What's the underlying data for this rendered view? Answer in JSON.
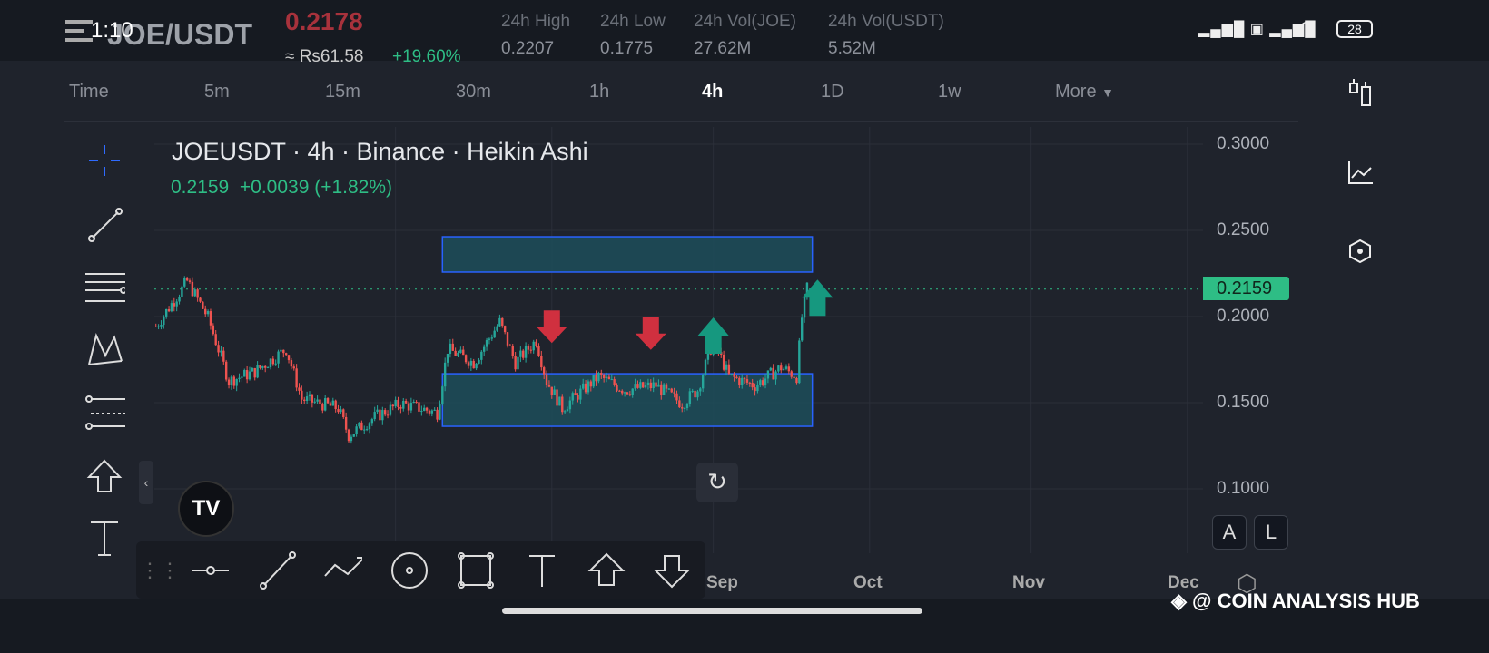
{
  "status": {
    "time": "1:10",
    "battery": "28"
  },
  "header": {
    "pair": "JOE/USDT",
    "price": "0.2178",
    "fiat": "≈ Rs61.58",
    "change": "+19.60%",
    "stats": [
      {
        "label": "24h High",
        "value": "0.2207"
      },
      {
        "label": "24h Low",
        "value": "0.1775"
      },
      {
        "label": "24h Vol(JOE)",
        "value": "27.62M"
      },
      {
        "label": "24h Vol(USDT)",
        "value": "5.52M"
      }
    ]
  },
  "timeframes": [
    "Time",
    "5m",
    "15m",
    "30m",
    "1h",
    "4h",
    "1D",
    "1w",
    "More"
  ],
  "active_timeframe": "4h",
  "legend": {
    "title": "JOEUSDT · 4h · Binance · Heikin Ashi",
    "values": "0.2159  +0.0039 (+1.82%)"
  },
  "price_axis": [
    "0.3000",
    "0.2500",
    "0.2000",
    "0.1500",
    "0.1000"
  ],
  "last_price": "0.2159",
  "time_axis": [
    "Sep",
    "Oct",
    "Nov",
    "Dec"
  ],
  "scale_buttons": [
    "A",
    "L"
  ],
  "watermark": "@ COIN ANALYSIS HUB",
  "colors": {
    "up": "#26a69a",
    "down": "#ef5350",
    "accent": "#2ebd85",
    "box": "#1d4e5a",
    "box_border": "#2962ff"
  },
  "chart_data": {
    "type": "candlestick",
    "xunit": "days from Sep 1",
    "xlim": [
      -107.3,
      94
    ],
    "ylim": [
      0.0835,
      0.3
    ],
    "close_path": [
      [
        -107,
        0.1942
      ],
      [
        -101,
        0.2205
      ],
      [
        -97,
        0.1995
      ],
      [
        -93,
        0.1626
      ],
      [
        -88,
        0.1679
      ],
      [
        -82,
        0.1811
      ],
      [
        -79,
        0.1521
      ],
      [
        -72,
        0.1468
      ],
      [
        -70,
        0.1311
      ],
      [
        -65,
        0.1416
      ],
      [
        -60,
        0.1495
      ],
      [
        -53,
        0.1442
      ],
      [
        -51,
        0.1811
      ],
      [
        -46,
        0.1732
      ],
      [
        -41,
        0.1968
      ],
      [
        -38,
        0.1732
      ],
      [
        -34,
        0.1863
      ],
      [
        -32,
        0.1626
      ],
      [
        -29,
        0.1468
      ],
      [
        -22,
        0.1653
      ],
      [
        -17,
        0.1574
      ],
      [
        -11,
        0.16
      ],
      [
        -6,
        0.1495
      ],
      [
        -3,
        0.1574
      ],
      [
        0,
        0.1863
      ],
      [
        3,
        0.1653
      ],
      [
        8,
        0.16
      ],
      [
        13,
        0.1705
      ],
      [
        16,
        0.1653
      ],
      [
        17,
        0.1995
      ],
      [
        18,
        0.2163
      ]
    ],
    "zones": [
      {
        "x": [
          -52,
          19
        ],
        "y": [
          0.2258,
          0.2463
        ]
      },
      {
        "x": [
          -52,
          19
        ],
        "y": [
          0.1363,
          0.1668
        ]
      }
    ],
    "arrows": [
      {
        "dir": "down",
        "x": -31,
        "y": 0.192
      },
      {
        "dir": "down",
        "x": -12,
        "y": 0.188
      },
      {
        "dir": "up",
        "x": 0,
        "y": 0.19
      },
      {
        "dir": "up",
        "x": 20,
        "y": 0.212
      }
    ]
  }
}
